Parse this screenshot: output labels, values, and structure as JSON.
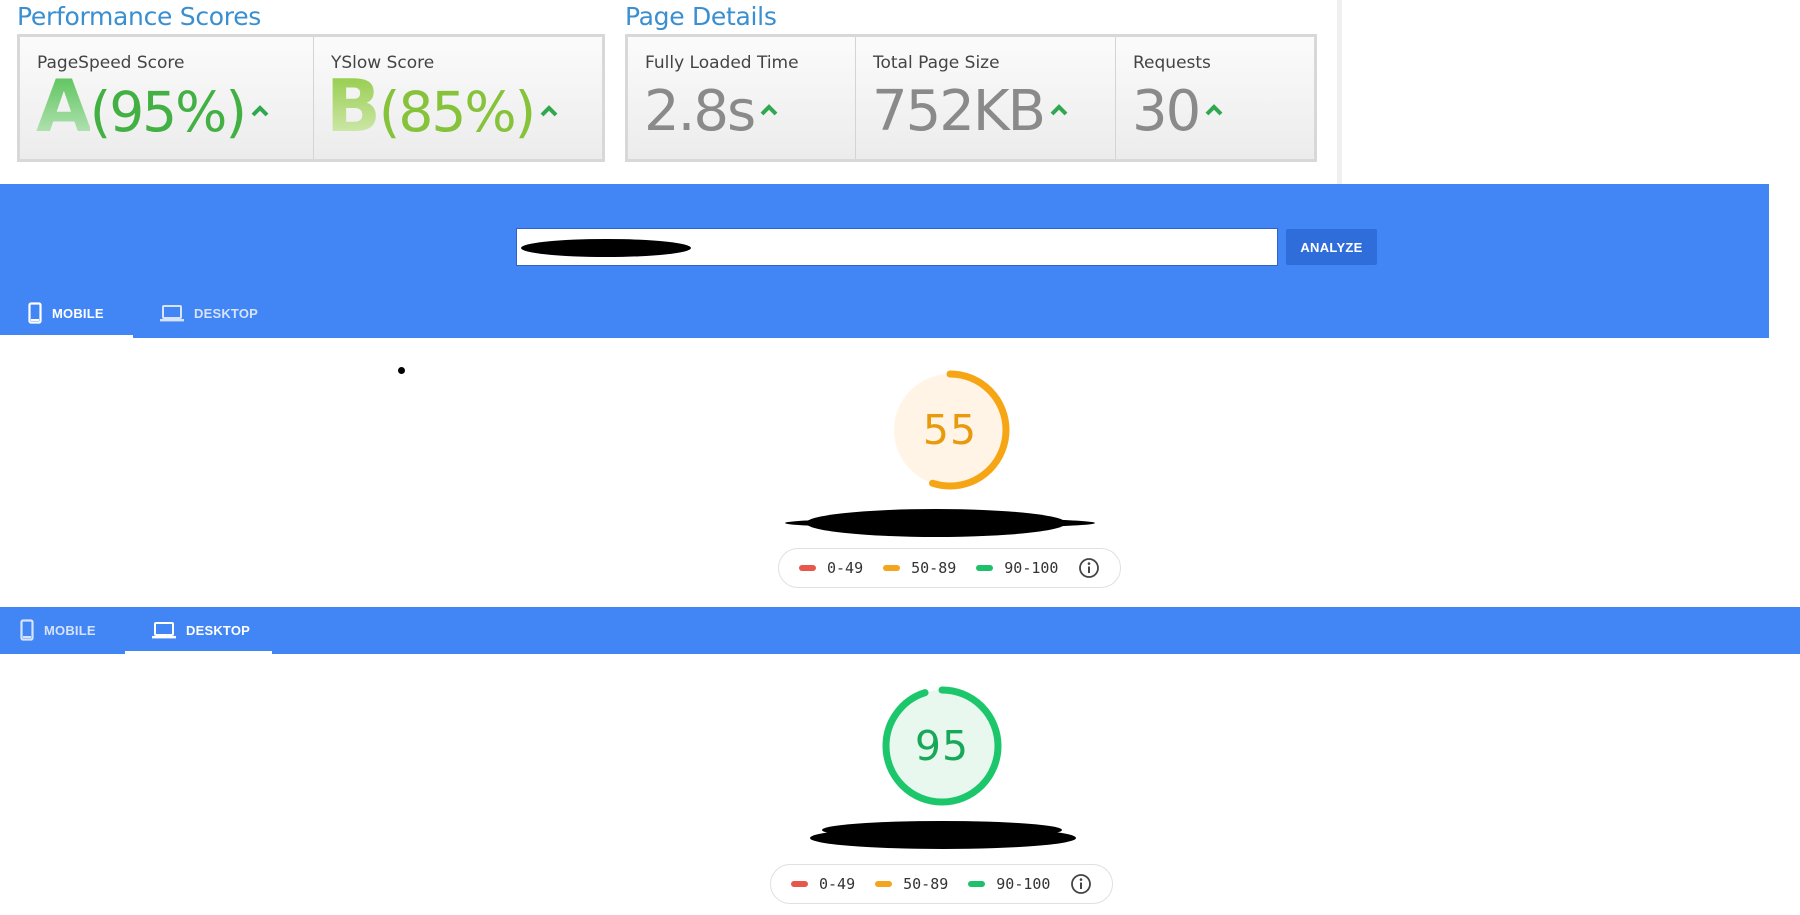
{
  "performance_scores": {
    "title": "Performance Scores",
    "items": [
      {
        "label": "PageSpeed Score",
        "grade": "A",
        "percent": "(95%)"
      },
      {
        "label": "YSlow Score",
        "grade": "B",
        "percent": "(85%)"
      }
    ]
  },
  "page_details": {
    "title": "Page Details",
    "items": [
      {
        "label": "Fully Loaded Time",
        "value": "2.8s"
      },
      {
        "label": "Total Page Size",
        "value": "752KB"
      },
      {
        "label": "Requests",
        "value": "30"
      }
    ]
  },
  "pagespeed": {
    "url_value": "",
    "analyze_label": "ANALYZE",
    "tabs_top": {
      "mobile": "MOBILE",
      "desktop": "DESKTOP",
      "active": "mobile"
    },
    "tabs_bottom": {
      "mobile": "MOBILE",
      "desktop": "DESKTOP",
      "active": "desktop"
    },
    "mobile_score": 55,
    "desktop_score": 95,
    "legend": [
      {
        "range": "0-49",
        "color": "#e8574c"
      },
      {
        "range": "50-89",
        "color": "#f2a51d"
      },
      {
        "range": "90-100",
        "color": "#1fc06b"
      }
    ]
  },
  "colors": {
    "brand_blue": "#4285f4",
    "average_orange": "#f6a615",
    "pass_green": "#1cc66b",
    "gt_title_blue": "#3a8fd0"
  }
}
